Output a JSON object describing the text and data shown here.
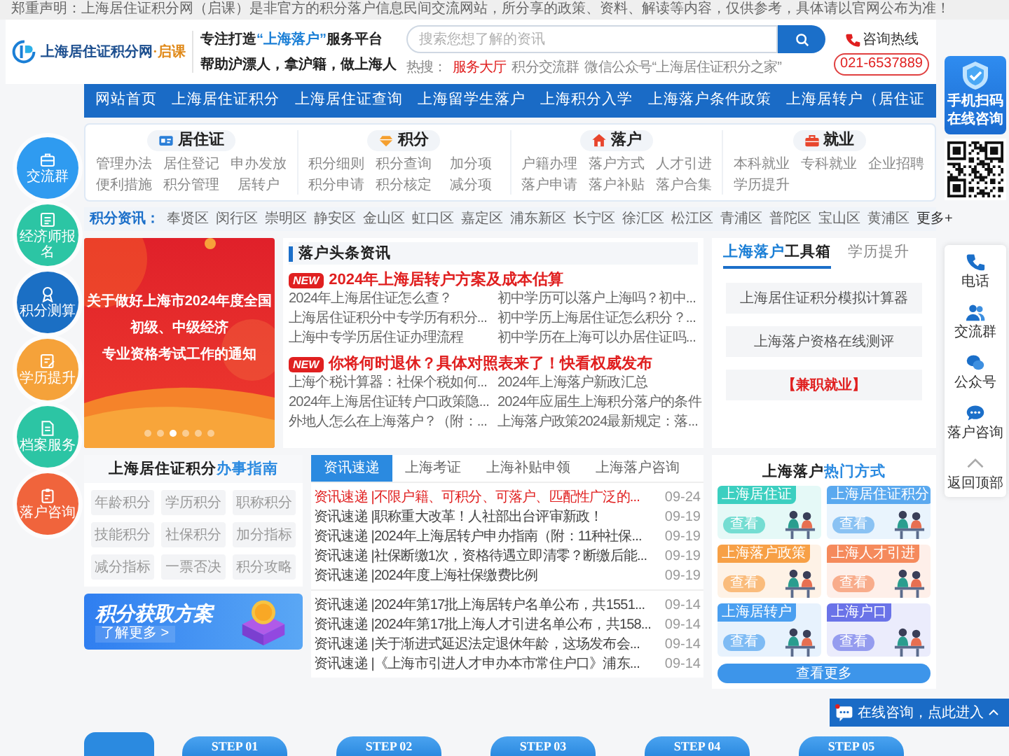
{
  "notice": "郑重声明：上海居住证积分网（启课）是非官方的积分落户信息民间交流网站，所分享的政策、资料、解读等内容，仅供参考，具体请以官网公布为准！",
  "header": {
    "logo": {
      "name": "上海居住证积分网",
      "brand": "·启课"
    },
    "slogan": {
      "prefix": "专注打造",
      "highlight": "“上海落户”",
      "suffix": "服务平台",
      "line2": "帮助沪漂人，拿沪籍，做上海人"
    },
    "search": {
      "placeholder": "搜索您想了解的资讯"
    },
    "hot": {
      "label": "热搜：",
      "links": [
        {
          "text": "服务大厅",
          "highlight": true
        },
        {
          "text": "积分交流群",
          "highlight": false
        },
        {
          "text": "微信公众号“上海居住证积分之家”",
          "highlight": false
        }
      ]
    },
    "hotline": {
      "label": "咨询热线",
      "number": "021-6537889"
    }
  },
  "nav": [
    "网站首页",
    "上海居住证积分",
    "上海居住证查询",
    "上海留学生落户",
    "上海积分入学",
    "上海落户条件政策",
    "上海居转户（居住证"
  ],
  "categories": [
    {
      "title": "居住证",
      "links": [
        "管理办法",
        "居住登记",
        "申办发放",
        "便利措施",
        "积分管理",
        "居转户"
      ]
    },
    {
      "title": "积分",
      "links": [
        "积分细则",
        "积分查询",
        "加分项",
        "积分申请",
        "积分核定",
        "减分项"
      ]
    },
    {
      "title": "落户",
      "links": [
        "户籍办理",
        "落户方式",
        "人才引进",
        "落户申请",
        "落户补贴",
        "落户合集"
      ]
    },
    {
      "title": "就业",
      "links": [
        "本科就业",
        "专科就业",
        "企业招聘",
        "学历提升"
      ]
    }
  ],
  "districts": {
    "label": "积分资讯：",
    "items": [
      "奉贤区",
      "闵行区",
      "崇明区",
      "静安区",
      "金山区",
      "虹口区",
      "嘉定区",
      "浦东新区",
      "长宁区",
      "徐汇区",
      "松江区",
      "青浦区",
      "普陀区",
      "宝山区",
      "黄浦区"
    ],
    "more": "更多+"
  },
  "banner": {
    "title_lines": [
      "关于做好上海市2024年度全国",
      "初级、中级经济",
      "专业资格考试工作的通知"
    ],
    "dots": [
      {
        "selected": false
      },
      {
        "selected": false
      },
      {
        "selected": true
      },
      {
        "selected": false
      },
      {
        "selected": false
      },
      {
        "selected": false
      }
    ]
  },
  "headlines": {
    "title": "落户头条资讯",
    "groups": [
      {
        "badge": "NEW",
        "headline": "2024年上海居转户方案及成本估算",
        "links": [
          "2024年上海居住证怎么查？",
          "初中学历可以落户上海吗？初中...",
          "上海居住证积分中专学历有积分...",
          "初中学历上海居住证怎么积分？...",
          "上海中专学历居住证办理流程",
          "初中学历在上海可以办居住证吗..."
        ]
      },
      {
        "badge": "NEW",
        "headline": "你将何时退休？具体对照表来了！快看权威发布",
        "links": [
          "上海个税计算器：社保个税如何...",
          "2024年上海落户新政汇总",
          "2024年上海居住证转户口政策隐...",
          "2024年应届生上海积分落户的条件",
          "外地人怎么在上海落户？（附：...",
          "上海落户政策2024最新规定：落..."
        ]
      }
    ]
  },
  "toolbox": {
    "tabs": [
      {
        "highlight": "上海落户",
        "label": "工具箱",
        "selected": true
      },
      {
        "label": "学历提升",
        "selected": false
      }
    ],
    "buttons": [
      {
        "text": "上海居住证积分模拟计算器",
        "emphasis": false
      },
      {
        "text": "上海落户资格在线测评",
        "emphasis": false
      },
      {
        "text": "【兼职就业】",
        "emphasis": true
      }
    ]
  },
  "guide": {
    "title": "上海居住证积分",
    "highlight": "办事指南",
    "items": [
      "年龄积分",
      "学历积分",
      "职称积分",
      "技能积分",
      "社保积分",
      "加分指标",
      "减分指标",
      "一票否决",
      "积分攻略"
    ]
  },
  "promo": {
    "title": "积分获取方案",
    "link": "了解更多 >"
  },
  "news": {
    "tabs": [
      {
        "label": "资讯速递",
        "selected": true
      },
      {
        "label": "上海考证",
        "selected": false
      },
      {
        "label": "上海补贴申领",
        "selected": false
      },
      {
        "label": "上海落户咨询",
        "selected": false
      }
    ],
    "groups": [
      {
        "items": [
          {
            "text": "资讯速递 |不限户籍、可积分、可落户、匹配性广泛的...",
            "date": "09-24",
            "hot": true
          },
          {
            "text": "资讯速递 |职称重大改革！人社部出台评审新政！",
            "date": "09-19",
            "hot": false
          },
          {
            "text": "资讯速递 |2024年上海居转户申办指南（附：11种社保...",
            "date": "09-19",
            "hot": false
          },
          {
            "text": "资讯速递 |社保断缴1次，资格待遇立即清零？断缴后能...",
            "date": "09-19",
            "hot": false
          },
          {
            "text": "资讯速递 |2024年度上海社保缴费比例",
            "date": "09-19",
            "hot": false
          }
        ]
      },
      {
        "items": [
          {
            "text": "资讯速递 |2024年第17批上海居转户名单公布，共1551...",
            "date": "09-14",
            "hot": false
          },
          {
            "text": "资讯速递 |2024年第17批上海人才引进名单公布，共158...",
            "date": "09-14",
            "hot": false
          },
          {
            "text": "资讯速递 |关于渐进式延迟法定退休年龄，这场发布会...",
            "date": "09-14",
            "hot": false
          },
          {
            "text": "资讯速递 |《上海市引进人才申办本市常住户口》浦东...",
            "date": "09-14",
            "hot": false
          }
        ]
      }
    ]
  },
  "hot_methods": {
    "title": "上海落户",
    "highlight": "热门方式",
    "cards": [
      {
        "label": "上海居住证",
        "action": "查看",
        "color": "#3ccfc0"
      },
      {
        "label": "上海居住证积分",
        "action": "查看",
        "color": "#5aa9ef"
      },
      {
        "label": "上海落户政策",
        "action": "查看",
        "color": "#f7a046"
      },
      {
        "label": "上海人才引进",
        "action": "查看",
        "color": "#f58a5c"
      },
      {
        "label": "上海居转户",
        "action": "查看",
        "color": "#4a9ff0"
      },
      {
        "label": "上海户口",
        "action": "查看",
        "color": "#6a73e8"
      }
    ],
    "more": "查看更多"
  },
  "quick_links": [
    {
      "label": "交流群",
      "color": "#2f9bf0"
    },
    {
      "label": "经济师报名",
      "color": "#2cc5a4"
    },
    {
      "label": "积分测算",
      "color": "#1b6fc4"
    },
    {
      "label": "学历提升",
      "color": "#f5a23a"
    },
    {
      "label": "档案服务",
      "color": "#2cc5a4"
    },
    {
      "label": "落户咨询",
      "color": "#f0643c"
    }
  ],
  "scan": {
    "lines": [
      "手机扫码",
      "在线咨询"
    ]
  },
  "side_tools": [
    "电话",
    "交流群",
    "公众号",
    "落户咨询",
    "返回顶部"
  ],
  "steps": [
    "STEP 01",
    "STEP 02",
    "STEP 03",
    "STEP 04",
    "STEP 05"
  ],
  "chat_bar": {
    "text": "在线咨询，点此进入"
  }
}
